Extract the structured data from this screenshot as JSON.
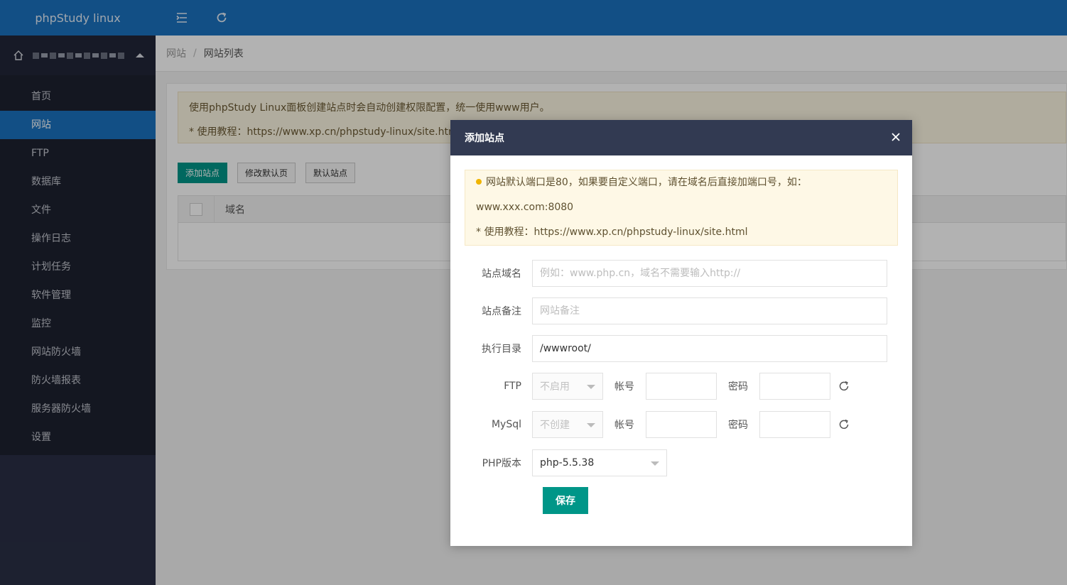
{
  "app": {
    "title": "phpStudy linux"
  },
  "user": {
    "name_obscured": ""
  },
  "sidebar": {
    "items": [
      {
        "label": "首页",
        "active": false
      },
      {
        "label": "网站",
        "active": true
      },
      {
        "label": "FTP",
        "active": false
      },
      {
        "label": "数据库",
        "active": false
      },
      {
        "label": "文件",
        "active": false
      },
      {
        "label": "操作日志",
        "active": false
      },
      {
        "label": "计划任务",
        "active": false
      },
      {
        "label": "软件管理",
        "active": false
      },
      {
        "label": "监控",
        "active": false
      },
      {
        "label": "网站防火墙",
        "active": false
      },
      {
        "label": "防火墙报表",
        "active": false
      },
      {
        "label": "服务器防火墙",
        "active": false
      },
      {
        "label": "设置",
        "active": false
      }
    ]
  },
  "breadcrumb": {
    "parent": "网站",
    "separator": "/",
    "current": "网站列表"
  },
  "page": {
    "notice": {
      "line1": "使用phpStudy Linux面板创建站点时会自动创建权限配置，统一使用www用户。",
      "line2": "* 使用教程：https://www.xp.cn/phpstudy-linux/site.html"
    },
    "buttons": {
      "add": "添加站点",
      "edit_default": "修改默认页",
      "default_site": "默认站点"
    },
    "table": {
      "col_domain": "域名"
    }
  },
  "modal": {
    "title": "添加站点",
    "tip": {
      "line1": "网站默认端口是80，如果要自定义端口，请在域名后直接加端口号，如：",
      "line2": "www.xxx.com:8080",
      "line3": "* 使用教程：https://www.xp.cn/phpstudy-linux/site.html"
    },
    "form": {
      "domain": {
        "label": "站点域名",
        "placeholder": "例如：www.php.cn，域名不需要输入http://",
        "value": ""
      },
      "remark": {
        "label": "站点备注",
        "placeholder": "网站备注",
        "value": ""
      },
      "dir": {
        "label": "执行目录",
        "value": "/wwwroot/"
      },
      "ftp": {
        "label": "FTP",
        "select": "不启用",
        "account_label": "帐号",
        "password_label": "密码"
      },
      "mysql": {
        "label": "MySql",
        "select": "不创建",
        "account_label": "帐号",
        "password_label": "密码"
      },
      "php": {
        "label": "PHP版本",
        "select": "php-5.5.38"
      }
    },
    "save_label": "保存"
  },
  "colors": {
    "primary_blue": "#1a72bf",
    "accent_green": "#009688",
    "modal_header": "#323a52",
    "sidebar": "#1d2130"
  }
}
